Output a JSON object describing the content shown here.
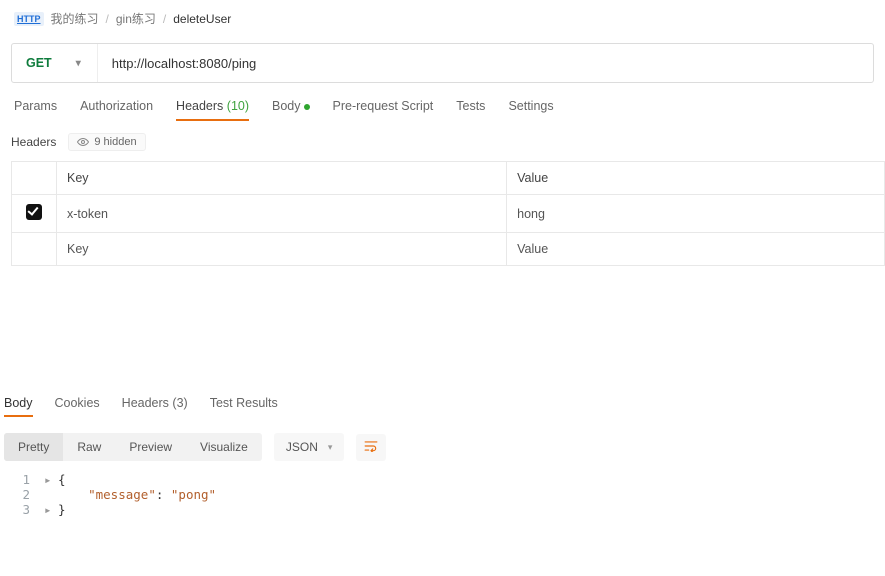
{
  "breadcrumb": {
    "b1": "我的练习",
    "b2": "gin练习",
    "b3": "deleteUser",
    "badge": "HTTP"
  },
  "request": {
    "method": "GET",
    "url": "http://localhost:8080/ping"
  },
  "req_tabs": {
    "params": "Params",
    "auth": "Authorization",
    "headers": "Headers",
    "headers_count": "(10)",
    "body": "Body",
    "prereq": "Pre-request Script",
    "tests": "Tests",
    "settings": "Settings"
  },
  "headers_panel": {
    "title": "Headers",
    "hidden_btn": "9 hidden",
    "col_key": "Key",
    "col_value": "Value",
    "rows": [
      {
        "key": "x-token",
        "value": "hong"
      }
    ],
    "ph_key": "Key",
    "ph_value": "Value"
  },
  "resp_tabs": {
    "body": "Body",
    "cookies": "Cookies",
    "headers": "Headers",
    "headers_count": "(3)",
    "tests": "Test Results"
  },
  "view": {
    "pretty": "Pretty",
    "raw": "Raw",
    "preview": "Preview",
    "visualize": "Visualize",
    "fmt": "JSON"
  },
  "chart_data": {
    "type": "table",
    "title": "Response JSON",
    "data": {
      "message": "pong"
    }
  },
  "code": {
    "l1": "{",
    "l2a": "\"message\"",
    "l2b": ": ",
    "l2c": "\"pong\"",
    "l3": "}"
  }
}
